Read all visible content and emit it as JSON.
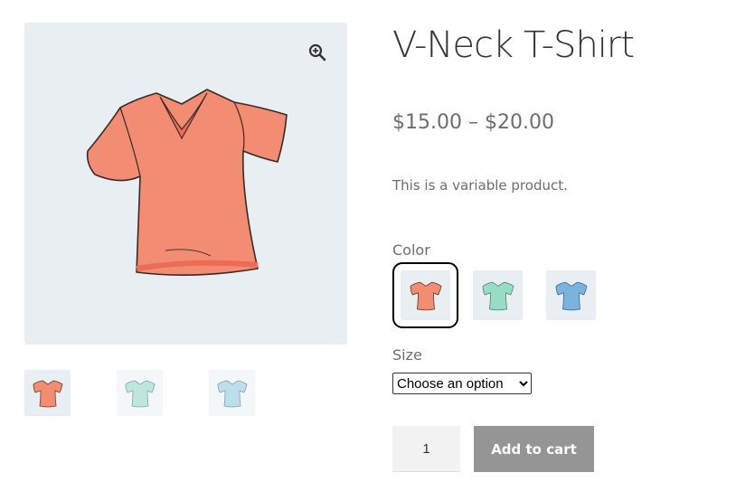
{
  "product": {
    "title": "V-Neck T-Shirt",
    "price": "$15.00 – $20.00",
    "description": "This is a variable product."
  },
  "gallery": {
    "zoom_icon": "zoom-in-icon",
    "main_color": "#f28c73",
    "thumbnails": [
      {
        "name": "red",
        "color": "#f28c73"
      },
      {
        "name": "green",
        "color": "#a8e0cf"
      },
      {
        "name": "blue",
        "color": "#a8d4e6"
      }
    ]
  },
  "color_option": {
    "label": "Color",
    "swatches": [
      {
        "name": "red",
        "color": "#f28c73",
        "selected": true
      },
      {
        "name": "green",
        "color": "#98dcc4"
      },
      {
        "name": "blue",
        "color": "#7ab3dd"
      }
    ]
  },
  "size_option": {
    "label": "Size",
    "selected": "Choose an option"
  },
  "cart": {
    "quantity": "1",
    "add_label": "Add to cart"
  }
}
